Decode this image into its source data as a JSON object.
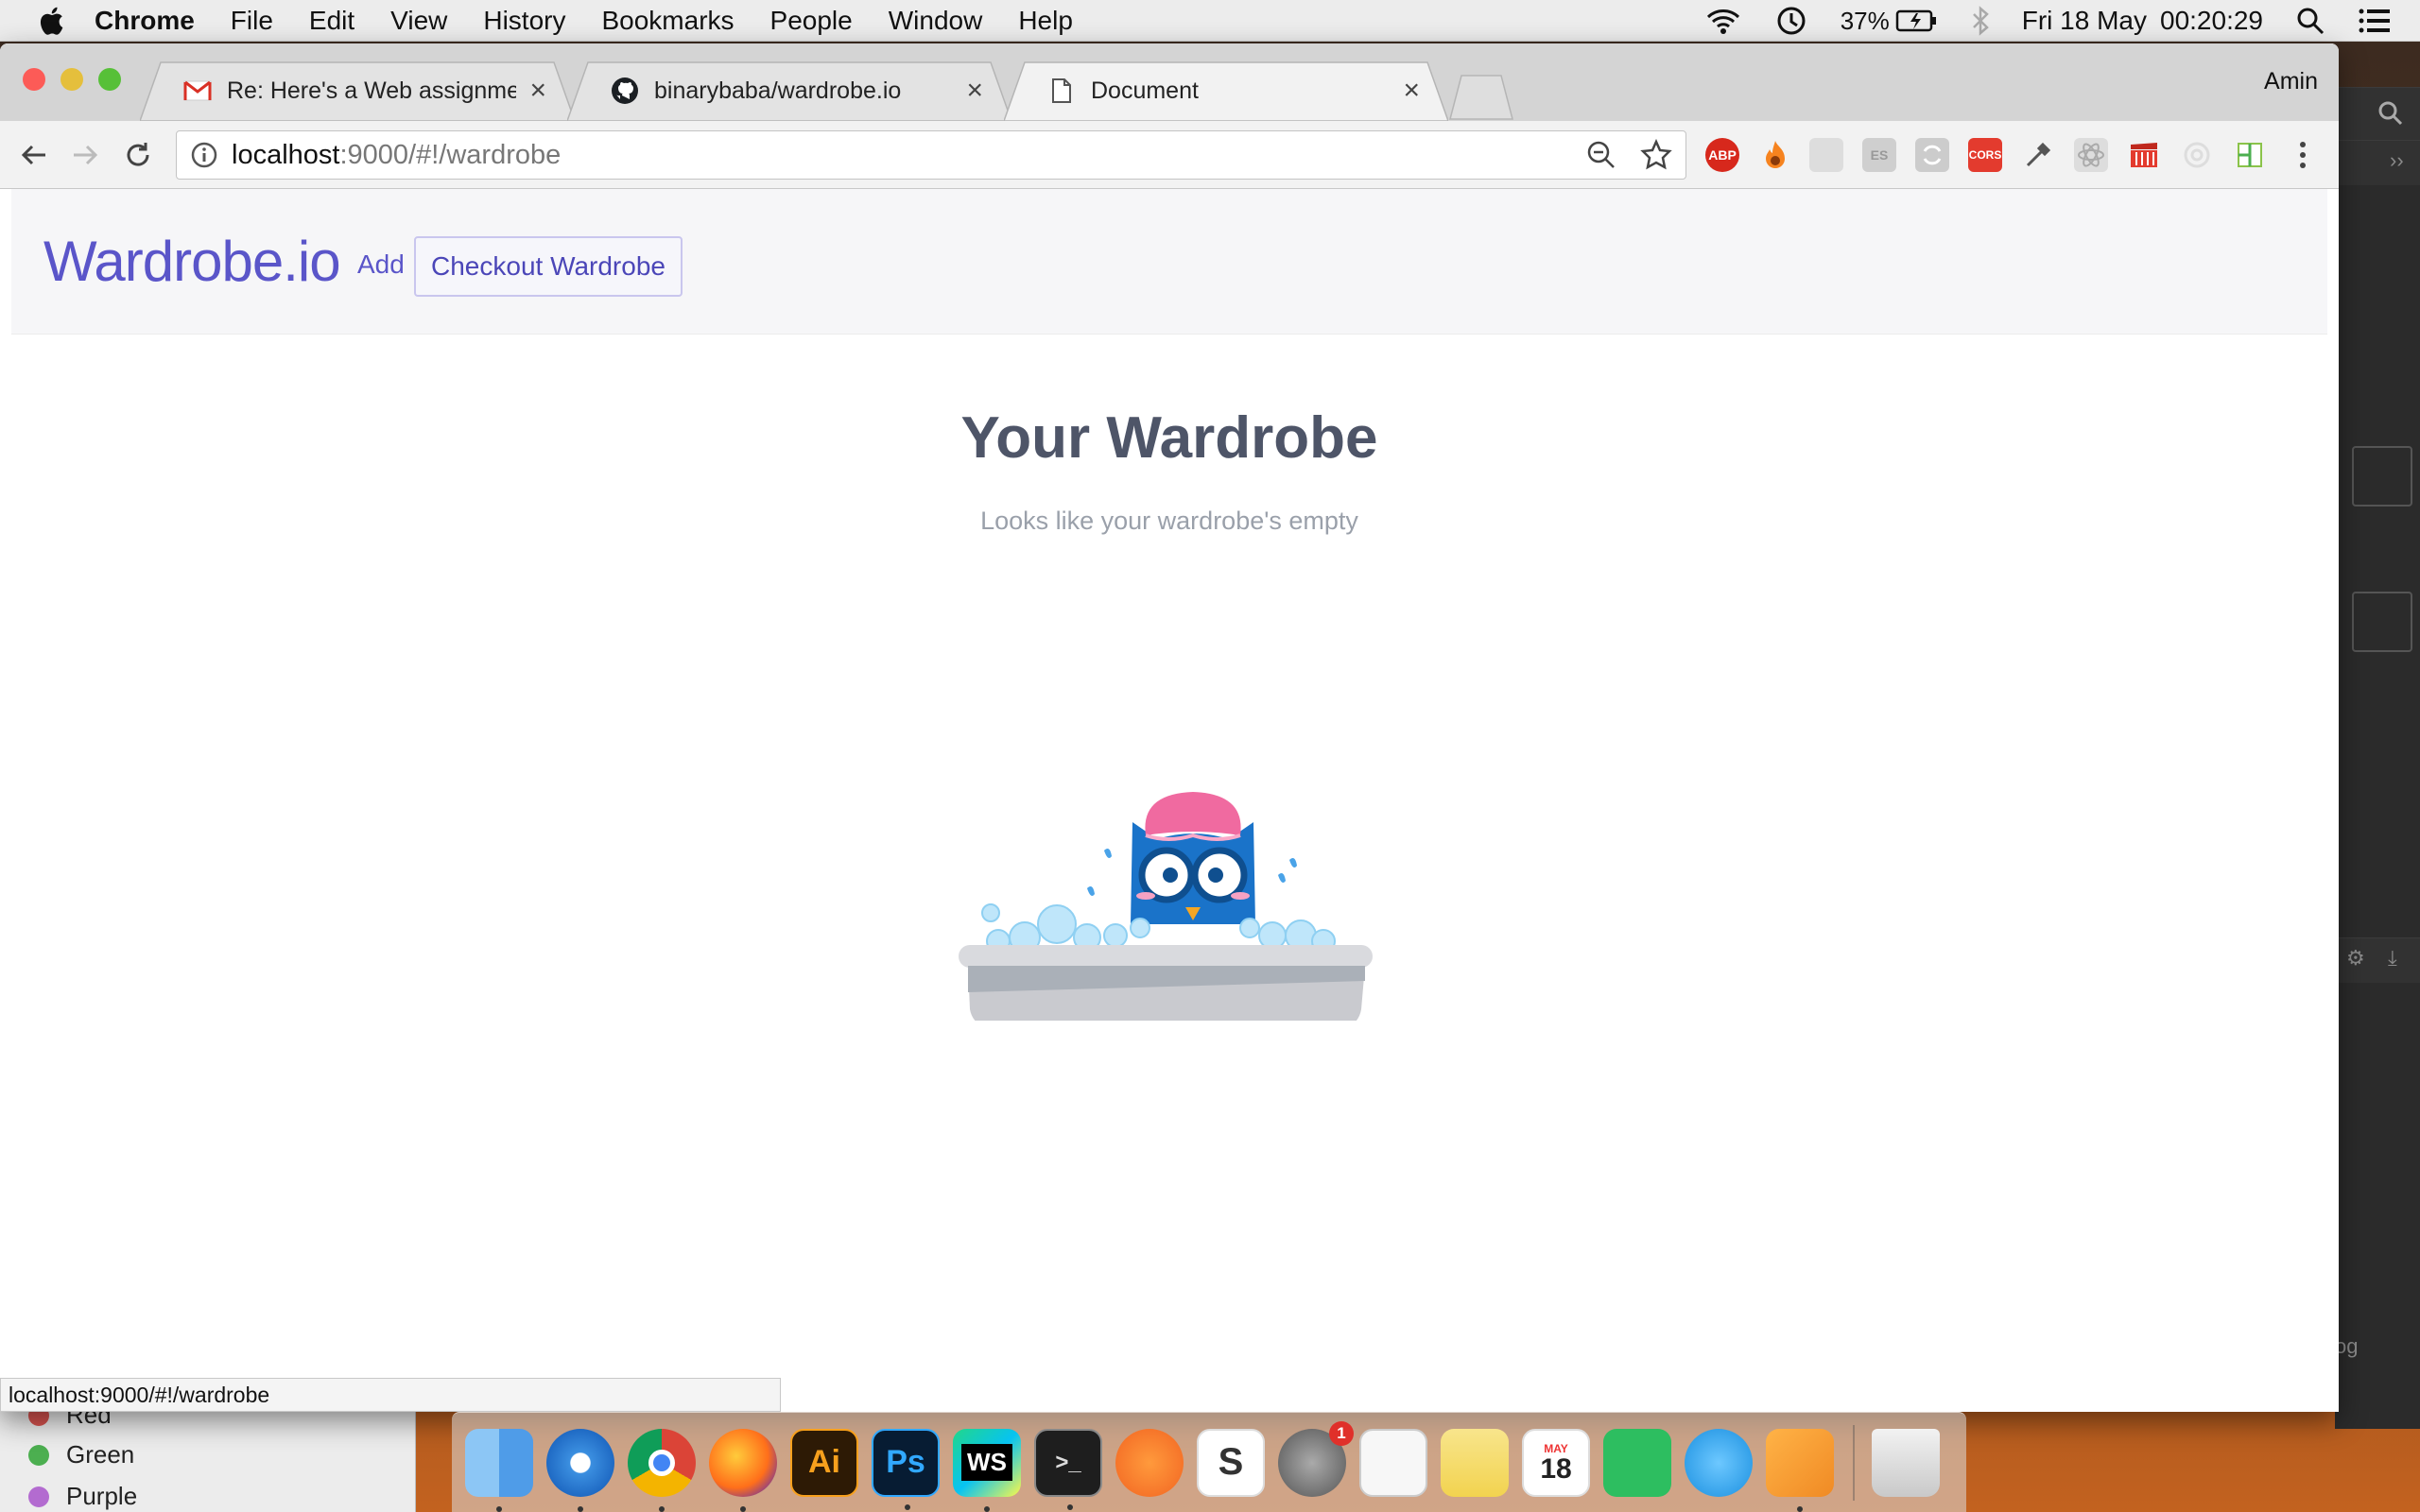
{
  "menubar": {
    "app": "Chrome",
    "items": [
      "File",
      "Edit",
      "View",
      "History",
      "Bookmarks",
      "People",
      "Window",
      "Help"
    ],
    "battery": "37%",
    "date": "Fri 18 May",
    "time": "00:20:29"
  },
  "chrome": {
    "profile": "Amin",
    "tabs": [
      {
        "title": "Re: Here's a Web assignment f",
        "favicon": "gmail-icon",
        "active": false
      },
      {
        "title": "binarybaba/wardrobe.io",
        "favicon": "github-icon",
        "active": false
      },
      {
        "title": "Document",
        "favicon": "document-icon",
        "active": true
      }
    ],
    "url_host": "localhost",
    "url_path": ":9000/#!/wardrobe",
    "extensions": [
      "ABP",
      "CORS",
      "ES"
    ],
    "status_url": "localhost:9000/#!/wardrobe"
  },
  "page": {
    "brand": "Wardrobe.io",
    "add_link": "Add",
    "checkout_button": "Checkout Wardrobe",
    "heading": "Your Wardrobe",
    "subtitle": "Looks like your wardrobe's empty"
  },
  "background_list": {
    "items": [
      {
        "label": "Red",
        "color": "#d9534f"
      },
      {
        "label": "Green",
        "color": "#4caf50"
      },
      {
        "label": "Purple",
        "color": "#b36bd0"
      }
    ]
  },
  "ide": {
    "text": "og"
  },
  "dock": {
    "calendar_month": "MAY",
    "calendar_day": "18",
    "notification_badge": "1",
    "apps": [
      "Finder",
      "Safari",
      "Chrome",
      "Firefox",
      "Ai",
      "Ps",
      "WS",
      "Terminal",
      "Sketch-like",
      "S",
      "System Preferences",
      "TextEdit",
      "Notes",
      "Calendar",
      "Evernote",
      "Teleport",
      "Pages",
      "Trash"
    ]
  },
  "colors": {
    "brand": "#5a55c9",
    "heading": "#4e5568",
    "muted": "#9aa0aa"
  }
}
